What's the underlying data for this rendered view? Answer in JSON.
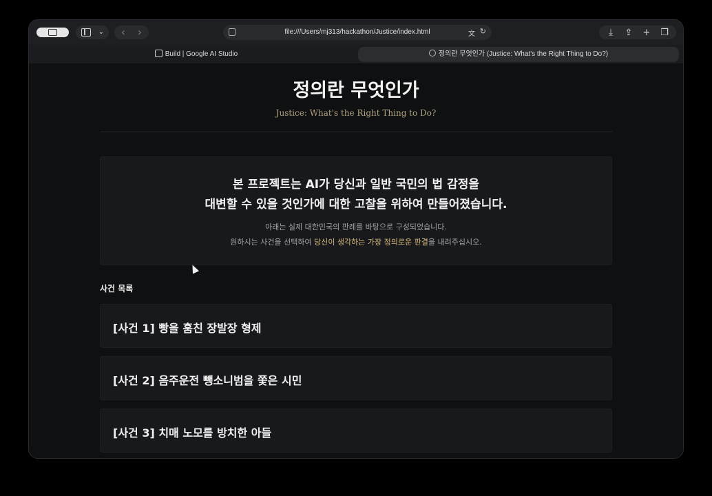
{
  "browser": {
    "url": "file:///Users/mj313/hackathon/Justice/index.html",
    "tabs": [
      {
        "label": "Build | Google AI Studio"
      },
      {
        "label": "정의란 무엇인가 (Justice: What's the Right Thing to Do?)"
      }
    ],
    "icons": {
      "sidebar": "sidebar-icon",
      "back": "‹",
      "forward": "›",
      "download": "⤓",
      "share": "⇪",
      "new_tab": "+",
      "tabs_overview": "❐",
      "reload": "↻",
      "translate": "文"
    }
  },
  "page": {
    "title": "정의란 무엇인가",
    "subtitle": "Justice: What's the Right Thing to Do?",
    "intro": {
      "line1": "본 프로젝트는 AI가 당신과 일반 국민의 법 감정을",
      "line2": "대변할 수 있을 것인가에 대한 고찰을 위하여 만들어졌습니다.",
      "line3": "아래는 실제 대한민국의 판례를 바탕으로 구성되었습니다.",
      "line4_pre": "원하시는 사건을 선택하여 ",
      "line4_highlight": "당신이 생각하는 가장 정의로운 판결",
      "line4_post": "을 내려주십시오."
    },
    "section_label": "사건 목록",
    "cases": [
      {
        "label": "[사건 1] 빵을 훔친 장발장 형제"
      },
      {
        "label": "[사건 2] 음주운전 뺑소니범을 쫓은 시민"
      },
      {
        "label": "[사건 3] 치매 노모를 방치한 아들"
      }
    ]
  },
  "colors": {
    "background": "#0f1012",
    "card": "#18191c",
    "accent": "#d6b97a",
    "subtitle": "#b5a584"
  }
}
